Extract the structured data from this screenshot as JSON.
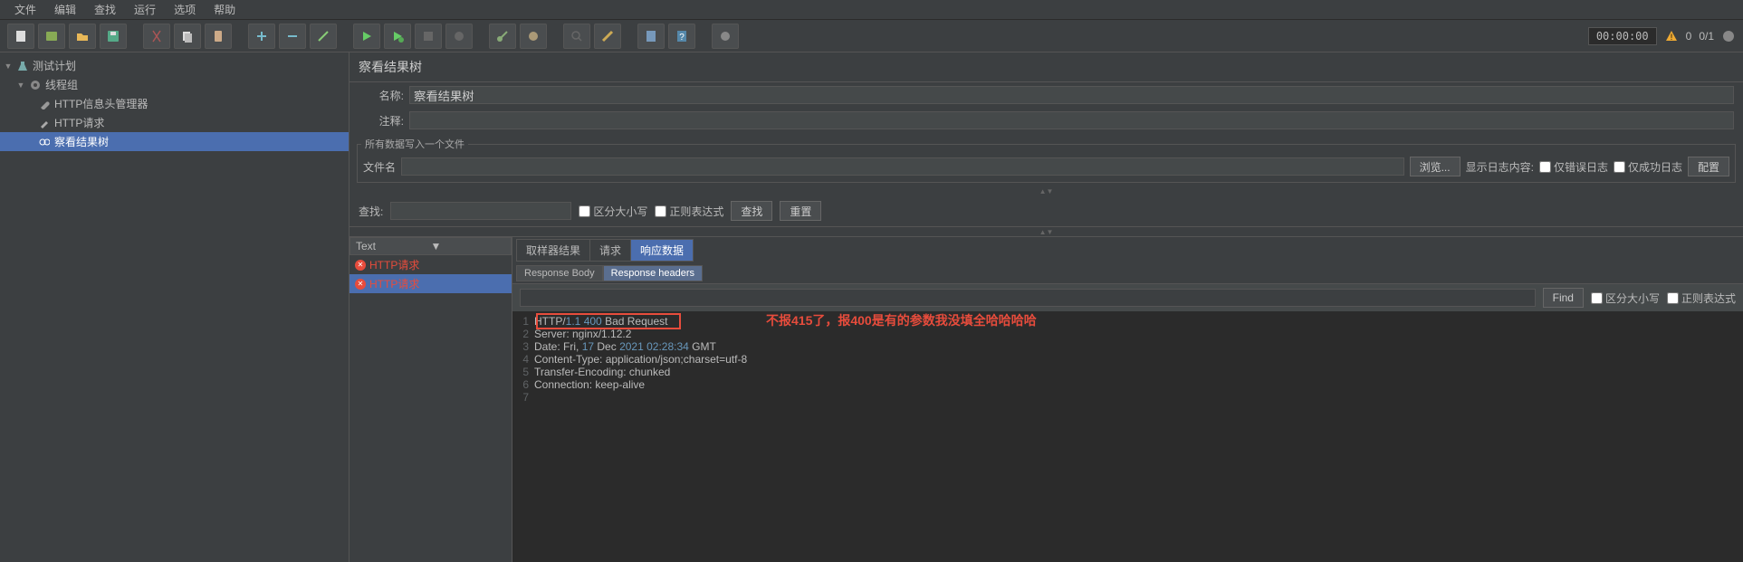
{
  "menu": {
    "file": "文件",
    "edit": "编辑",
    "search": "查找",
    "run": "运行",
    "options": "选项",
    "help": "帮助"
  },
  "status": {
    "timer": "00:00:00",
    "counts": "0/1",
    "errors": "0"
  },
  "tree": {
    "plan": "测试计划",
    "thread_group": "线程组",
    "header_mgr": "HTTP信息头管理器",
    "http_request": "HTTP请求",
    "results_tree": "察看结果树"
  },
  "panel": {
    "title": "察看结果树",
    "name_label": "名称:",
    "name_value": "察看结果树",
    "comment_label": "注释:",
    "comment_value": "",
    "write_all": "所有数据写入一个文件",
    "filename_label": "文件名",
    "filename_value": "",
    "browse": "浏览...",
    "show_log": "显示日志内容:",
    "only_error": "仅错误日志",
    "only_success": "仅成功日志",
    "configure": "配置"
  },
  "search": {
    "label": "查找:",
    "value": "",
    "case": "区分大小写",
    "regex": "正则表达式",
    "find_btn": "查找",
    "reset_btn": "重置"
  },
  "sampler": {
    "dropdown": "Text",
    "tab_result": "取样器结果",
    "tab_request": "请求",
    "tab_response": "响应数据",
    "items": [
      {
        "label": "HTTP请求"
      },
      {
        "label": "HTTP请求"
      }
    ]
  },
  "response": {
    "tab_body": "Response Body",
    "tab_headers": "Response headers",
    "find": "Find",
    "case": "区分大小写",
    "regex": "正则表达式",
    "lines": [
      {
        "n": "1",
        "prefix": "HTTP/",
        "ver": "1.1",
        "sp": " ",
        "code": "400",
        "rest": " Bad Request"
      },
      {
        "n": "2",
        "text": "Server: nginx/1.12.2"
      },
      {
        "n": "3",
        "prefix": "Date: ",
        "day": "Fri, ",
        "dn": "17",
        "mon": " Dec ",
        "yr": "2021",
        "sp2": " ",
        "time": "02:28:34",
        "tz": " GMT"
      },
      {
        "n": "4",
        "text": "Content-Type: application/json;charset=utf-8"
      },
      {
        "n": "5",
        "text": "Transfer-Encoding: chunked"
      },
      {
        "n": "6",
        "text": "Connection: keep-alive"
      },
      {
        "n": "7",
        "text": ""
      }
    ]
  },
  "annotation": "不报415了，报400是有的参数我没填全哈哈哈哈"
}
